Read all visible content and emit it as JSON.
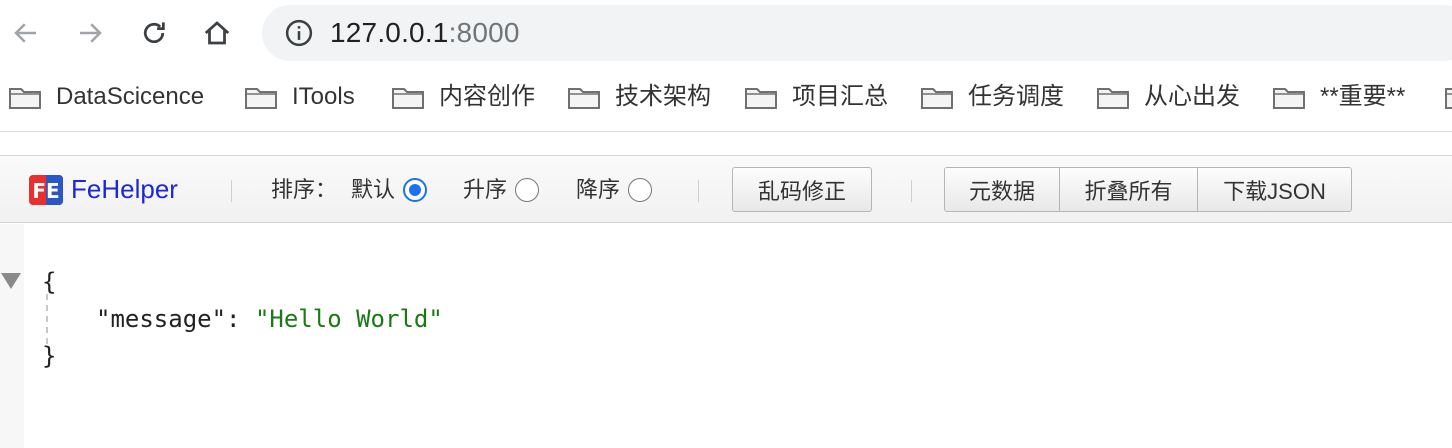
{
  "browser": {
    "address": {
      "host": "127.0.0.1",
      "port": ":8000"
    },
    "nav_icons": [
      "back-icon",
      "forward-icon",
      "reload-icon",
      "home-icon",
      "info-icon"
    ]
  },
  "bookmarks": [
    {
      "label": "DataScicence"
    },
    {
      "label": "ITools"
    },
    {
      "label": "内容创作"
    },
    {
      "label": "技术架构"
    },
    {
      "label": "项目汇总"
    },
    {
      "label": "任务调度"
    },
    {
      "label": "从心出发"
    },
    {
      "label": "**重要**"
    }
  ],
  "fehelper": {
    "logo_text": "FE",
    "title": "FeHelper",
    "sort_label": "排序：",
    "sort_options": [
      {
        "label": "默认",
        "checked": true
      },
      {
        "label": "升序",
        "checked": false
      },
      {
        "label": "降序",
        "checked": false
      }
    ],
    "fix_encoding_button": "乱码修正",
    "group_buttons": [
      "元数据",
      "折叠所有",
      "下载JSON"
    ]
  },
  "json_view": {
    "open_brace": "{",
    "close_brace": "}",
    "entries": [
      {
        "key": "\"message\"",
        "colon": ": ",
        "value": "\"Hello World\""
      }
    ]
  },
  "colors": {
    "accent": "#1a73e8",
    "fehelper_title": "#1a28d8",
    "json_string": "#1a7a15",
    "omnibox_bg": "#f1f3f4"
  }
}
